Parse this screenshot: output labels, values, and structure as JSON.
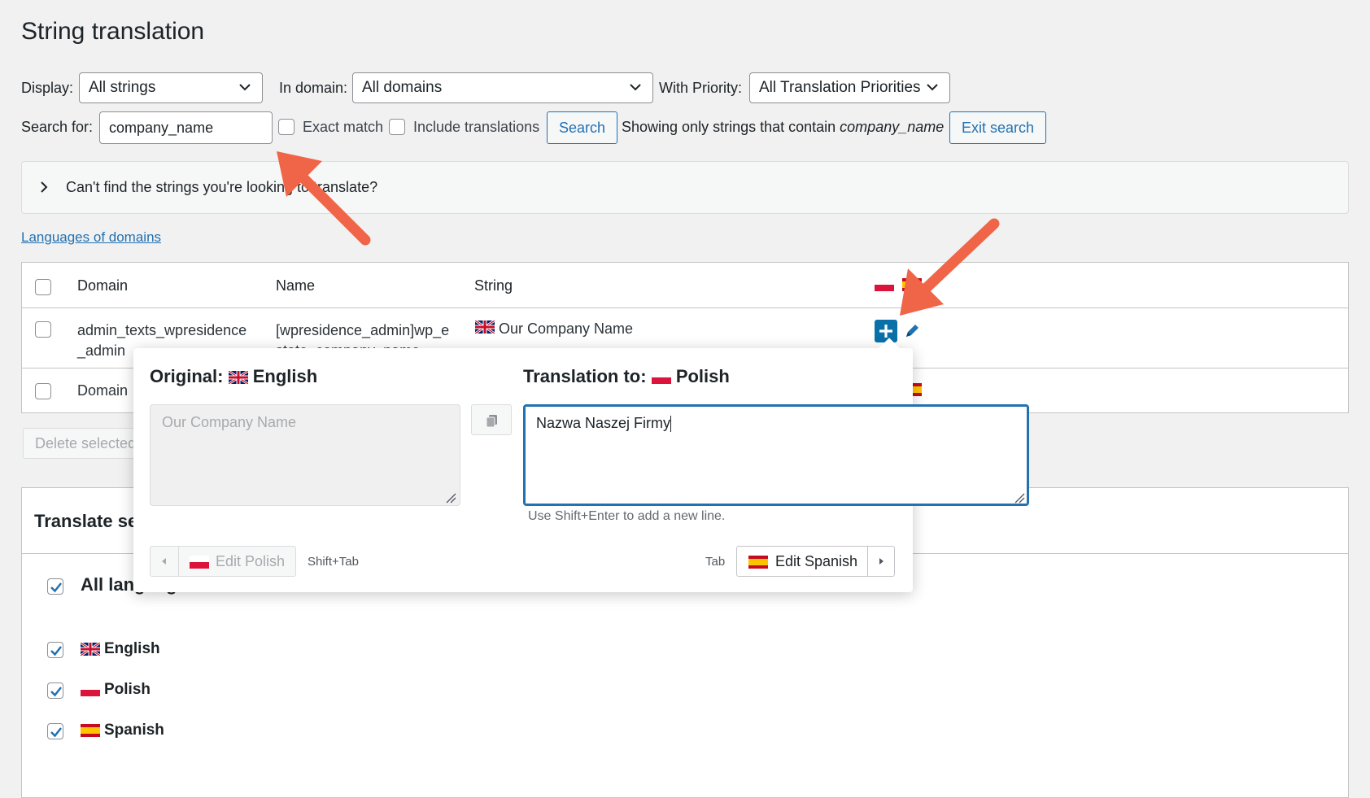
{
  "page": {
    "title": "String translation"
  },
  "filters": {
    "display_label": "Display:",
    "display_value": "All strings",
    "domain_label": "In domain:",
    "domain_value": "All domains",
    "priority_label": "With Priority:",
    "priority_value": "All Translation Priorities",
    "search_label": "Search for:",
    "search_value": "company_name",
    "exact_match_label": "Exact match",
    "include_translations_label": "Include translations",
    "search_button": "Search",
    "showing_prefix": "Showing only strings that contain",
    "showing_term": "company_name",
    "exit_search_button": "Exit search"
  },
  "help_panel": {
    "text": "Can't find the strings you're looking to translate?"
  },
  "languages_of_domains_link": "Languages of domains",
  "table": {
    "headers": {
      "domain": "Domain",
      "name": "Name",
      "string": "String"
    },
    "rows": [
      {
        "domain_line1": "admin_texts_wpresidence",
        "domain_line2": "_admin",
        "name_line1": "[wpresidence_admin]wp_e",
        "name_line2": "state_company_name",
        "string": "Our Company Name"
      },
      {
        "domain_line1": "Domain"
      }
    ]
  },
  "delete_button": "Delete selected strings",
  "translate_section": {
    "title": "Translate selected strings",
    "all_languages": "All languages",
    "languages": [
      "English",
      "Polish",
      "Spanish"
    ]
  },
  "popup": {
    "original_label": "Original:",
    "original_lang": "English",
    "translation_label": "Translation to:",
    "translation_lang": "Polish",
    "original_placeholder": "Our Company Name",
    "translation_value": "Nazwa Naszej Firmy",
    "hint": "Use Shift+Enter to add a new line.",
    "prev_button": "Edit Polish",
    "prev_shortcut": "Shift+Tab",
    "next_shortcut": "Tab",
    "next_button": "Edit Spanish"
  },
  "colors": {
    "accent": "#2271b1",
    "annotation_arrow": "#f06548",
    "add_button": "#0a70a8"
  }
}
